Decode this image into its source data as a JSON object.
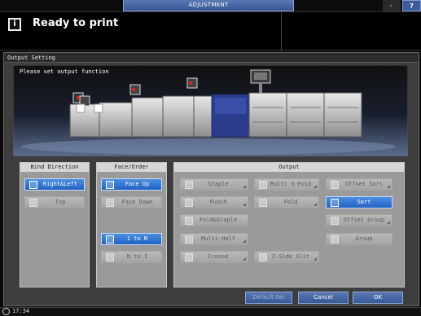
{
  "header": {
    "tab_label": "ADJUSTMENT",
    "volume_icon": "speaker-icon",
    "help_label": "?"
  },
  "status": {
    "icon": "info-icon",
    "icon_glyph": "i",
    "text": "Ready to print"
  },
  "window": {
    "title": "Output Setting",
    "instruction": "Please set output function"
  },
  "bind_direction": {
    "title": "Bind Direction",
    "buttons": [
      {
        "label": "Right&Left",
        "state": "selected"
      },
      {
        "label": "Top",
        "state": "disabled"
      }
    ]
  },
  "face_order": {
    "title": "Face/Order",
    "buttons": [
      {
        "label": "Face Up",
        "state": "selected"
      },
      {
        "label": "Face Down",
        "state": "disabled"
      },
      {
        "label": "1 to N",
        "state": "selected"
      },
      {
        "label": "N to 1",
        "state": "disabled"
      }
    ]
  },
  "output": {
    "title": "Output",
    "buttons": [
      {
        "label": "Staple",
        "state": "disabled"
      },
      {
        "label": "Punch",
        "state": "disabled"
      },
      {
        "label": "Fold&Staple",
        "state": "disabled"
      },
      {
        "label": "Multi Half",
        "state": "disabled"
      },
      {
        "label": "Crease",
        "state": "disabled"
      },
      {
        "label": "Multi 3-Fold",
        "state": "disabled"
      },
      {
        "label": "Fold",
        "state": "disabled"
      },
      {
        "label": "2-Side Slit",
        "state": "disabled"
      },
      {
        "label": "Offset Sort",
        "state": "disabled"
      },
      {
        "label": "Sort",
        "state": "selected"
      },
      {
        "label": "Offset Group",
        "state": "disabled"
      },
      {
        "label": "Group",
        "state": "disabled"
      }
    ]
  },
  "footer": {
    "default_set": "Default Set",
    "cancel": "Cancel",
    "ok": "OK",
    "time": "17:34"
  },
  "colors": {
    "selected_blue": "#2f78d8",
    "header_blue": "#4466a0",
    "panel_gray": "#9a9a9a"
  }
}
